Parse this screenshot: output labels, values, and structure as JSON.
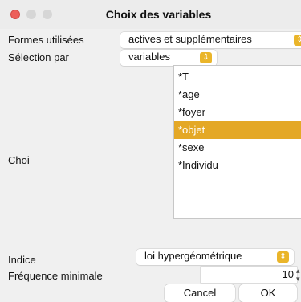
{
  "window": {
    "title": "Choix des variables"
  },
  "form": {
    "formes_label": "Formes utilisées",
    "formes_value": "actives et supplémentaires",
    "selection_label": "Sélection par",
    "selection_value": "variables",
    "choix_label": "Choi",
    "variables": [
      "*T",
      "*age",
      "*foyer",
      "*objet",
      "*sexe",
      "*Individu"
    ],
    "selected_variable": "*objet",
    "indice_label": "Indice",
    "indice_value": "loi hypergéométrique",
    "frequence_label": "Fréquence minimale",
    "frequence_value": "10"
  },
  "buttons": {
    "cancel": "Cancel",
    "ok": "OK"
  },
  "colors": {
    "accent": "#eab52a",
    "selection": "#e4a826",
    "close": "#ed5f5a"
  },
  "icons": {
    "popup": "chevron-up-down-icon",
    "stepper": "stepper-arrows-icon"
  }
}
